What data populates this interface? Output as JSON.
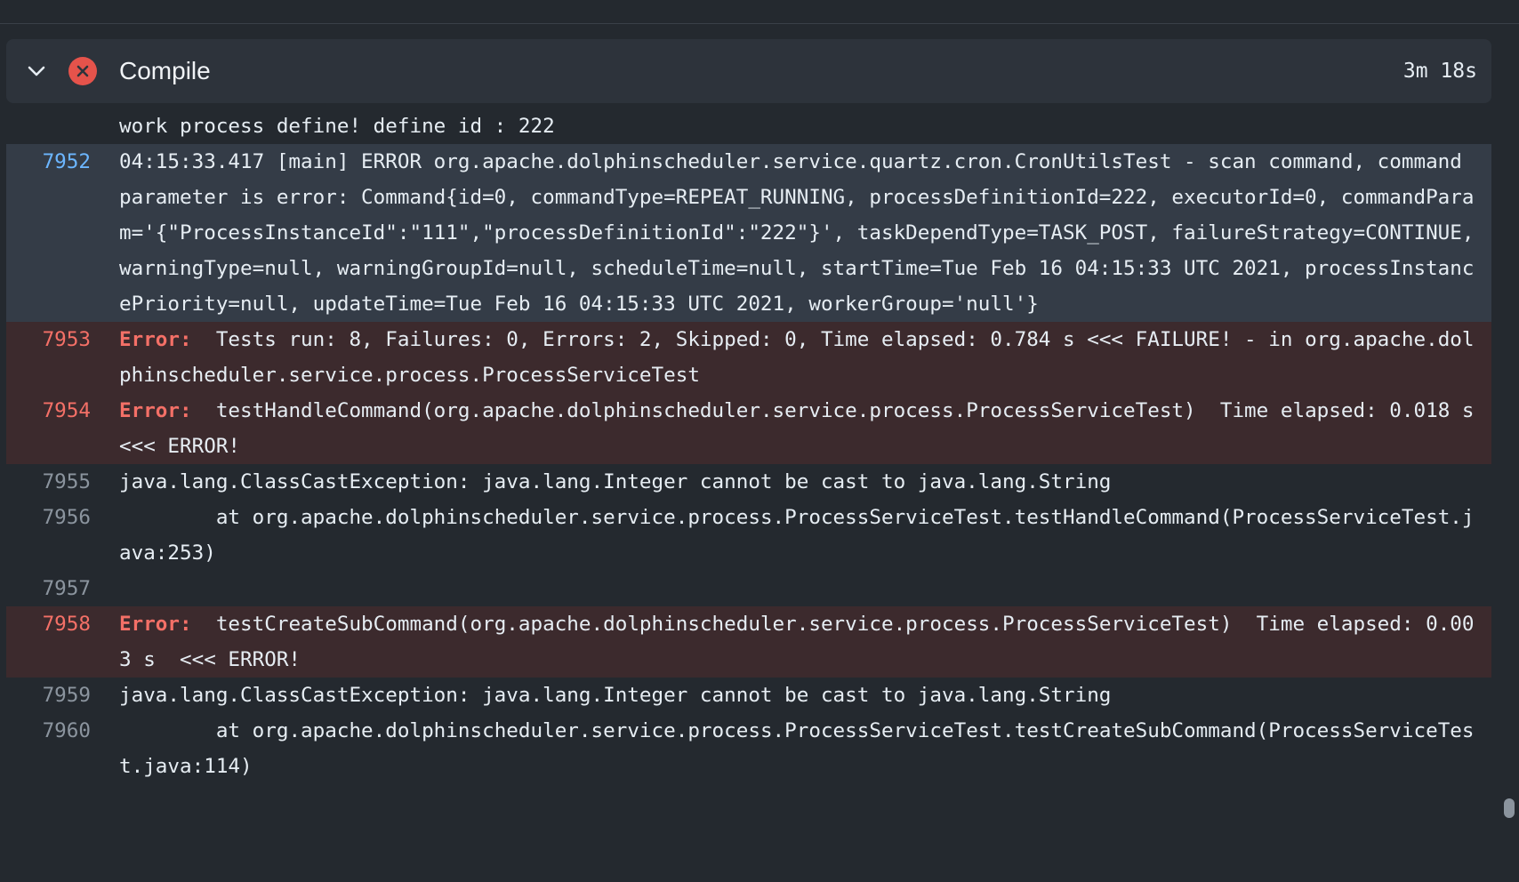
{
  "step": {
    "title": "Compile",
    "duration": "3m 18s",
    "status": "failure",
    "status_color": "#e5534b",
    "chevron_icon": "chevron-down-icon",
    "status_icon": "x-circle-icon"
  },
  "log": {
    "lines": [
      {
        "number": "",
        "text": "work process define! define id : 222",
        "kind": "normal"
      },
      {
        "number": "7952",
        "text": "04:15:33.417 [main] ERROR org.apache.dolphinscheduler.service.quartz.cron.CronUtilsTest - scan command, command parameter is error: Command{id=0, commandType=REPEAT_RUNNING, processDefinitionId=222, executorId=0, commandParam='{\"ProcessInstanceId\":\"111\",\"processDefinitionId\":\"222\"}', taskDependType=TASK_POST, failureStrategy=CONTINUE, warningType=null, warningGroupId=null, scheduleTime=null, startTime=Tue Feb 16 04:15:33 UTC 2021, processInstancePriority=null, updateTime=Tue Feb 16 04:15:33 UTC 2021, workerGroup='null'}",
        "kind": "selected"
      },
      {
        "number": "7953",
        "label": "Error:",
        "text": "  Tests run: 8, Failures: 0, Errors: 2, Skipped: 0, Time elapsed: 0.784 s <<< FAILURE! - in org.apache.dolphinscheduler.service.process.ProcessServiceTest",
        "kind": "error"
      },
      {
        "number": "7954",
        "label": "Error:",
        "text": "  testHandleCommand(org.apache.dolphinscheduler.service.process.ProcessServiceTest)  Time elapsed: 0.018 s  <<< ERROR!",
        "kind": "error"
      },
      {
        "number": "7955",
        "text": "java.lang.ClassCastException: java.lang.Integer cannot be cast to java.lang.String",
        "kind": "normal"
      },
      {
        "number": "7956",
        "text": "        at org.apache.dolphinscheduler.service.process.ProcessServiceTest.testHandleCommand(ProcessServiceTest.java:253)",
        "kind": "normal"
      },
      {
        "number": "7957",
        "text": "",
        "kind": "normal"
      },
      {
        "number": "7958",
        "label": "Error:",
        "text": "  testCreateSubCommand(org.apache.dolphinscheduler.service.process.ProcessServiceTest)  Time elapsed: 0.003 s  <<< ERROR!",
        "kind": "error"
      },
      {
        "number": "7959",
        "text": "java.lang.ClassCastException: java.lang.Integer cannot be cast to java.lang.String",
        "kind": "normal"
      },
      {
        "number": "7960",
        "text": "        at org.apache.dolphinscheduler.service.process.ProcessServiceTest.testCreateSubCommand(ProcessServiceTest.java:114)",
        "kind": "normal"
      }
    ]
  }
}
